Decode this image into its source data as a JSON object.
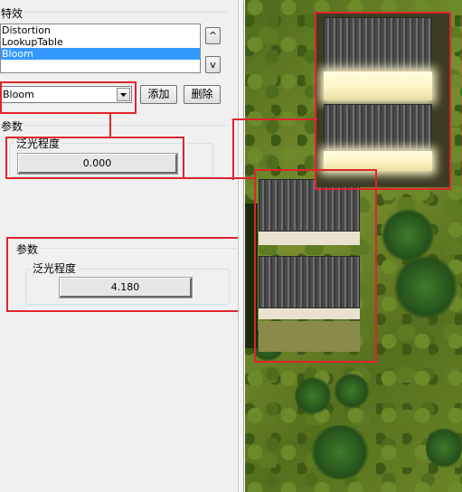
{
  "effects_panel": {
    "title": "特效",
    "effects": [
      "Distortion",
      "LookupTable",
      "Bloom"
    ],
    "selected_index": 2,
    "scroll_up": "^",
    "scroll_down": "v",
    "combo_value": "Bloom",
    "add_label": "添加",
    "delete_label": "删除"
  },
  "params_panel": {
    "title": "参数",
    "field_label": "泛光程度",
    "value": "0.000"
  },
  "zoom_callout": {
    "title": "参数",
    "field_label": "泛光程度",
    "value": "4.180"
  },
  "colors": {
    "highlight_red": "#e0242c",
    "selection_blue": "#3399ff"
  }
}
